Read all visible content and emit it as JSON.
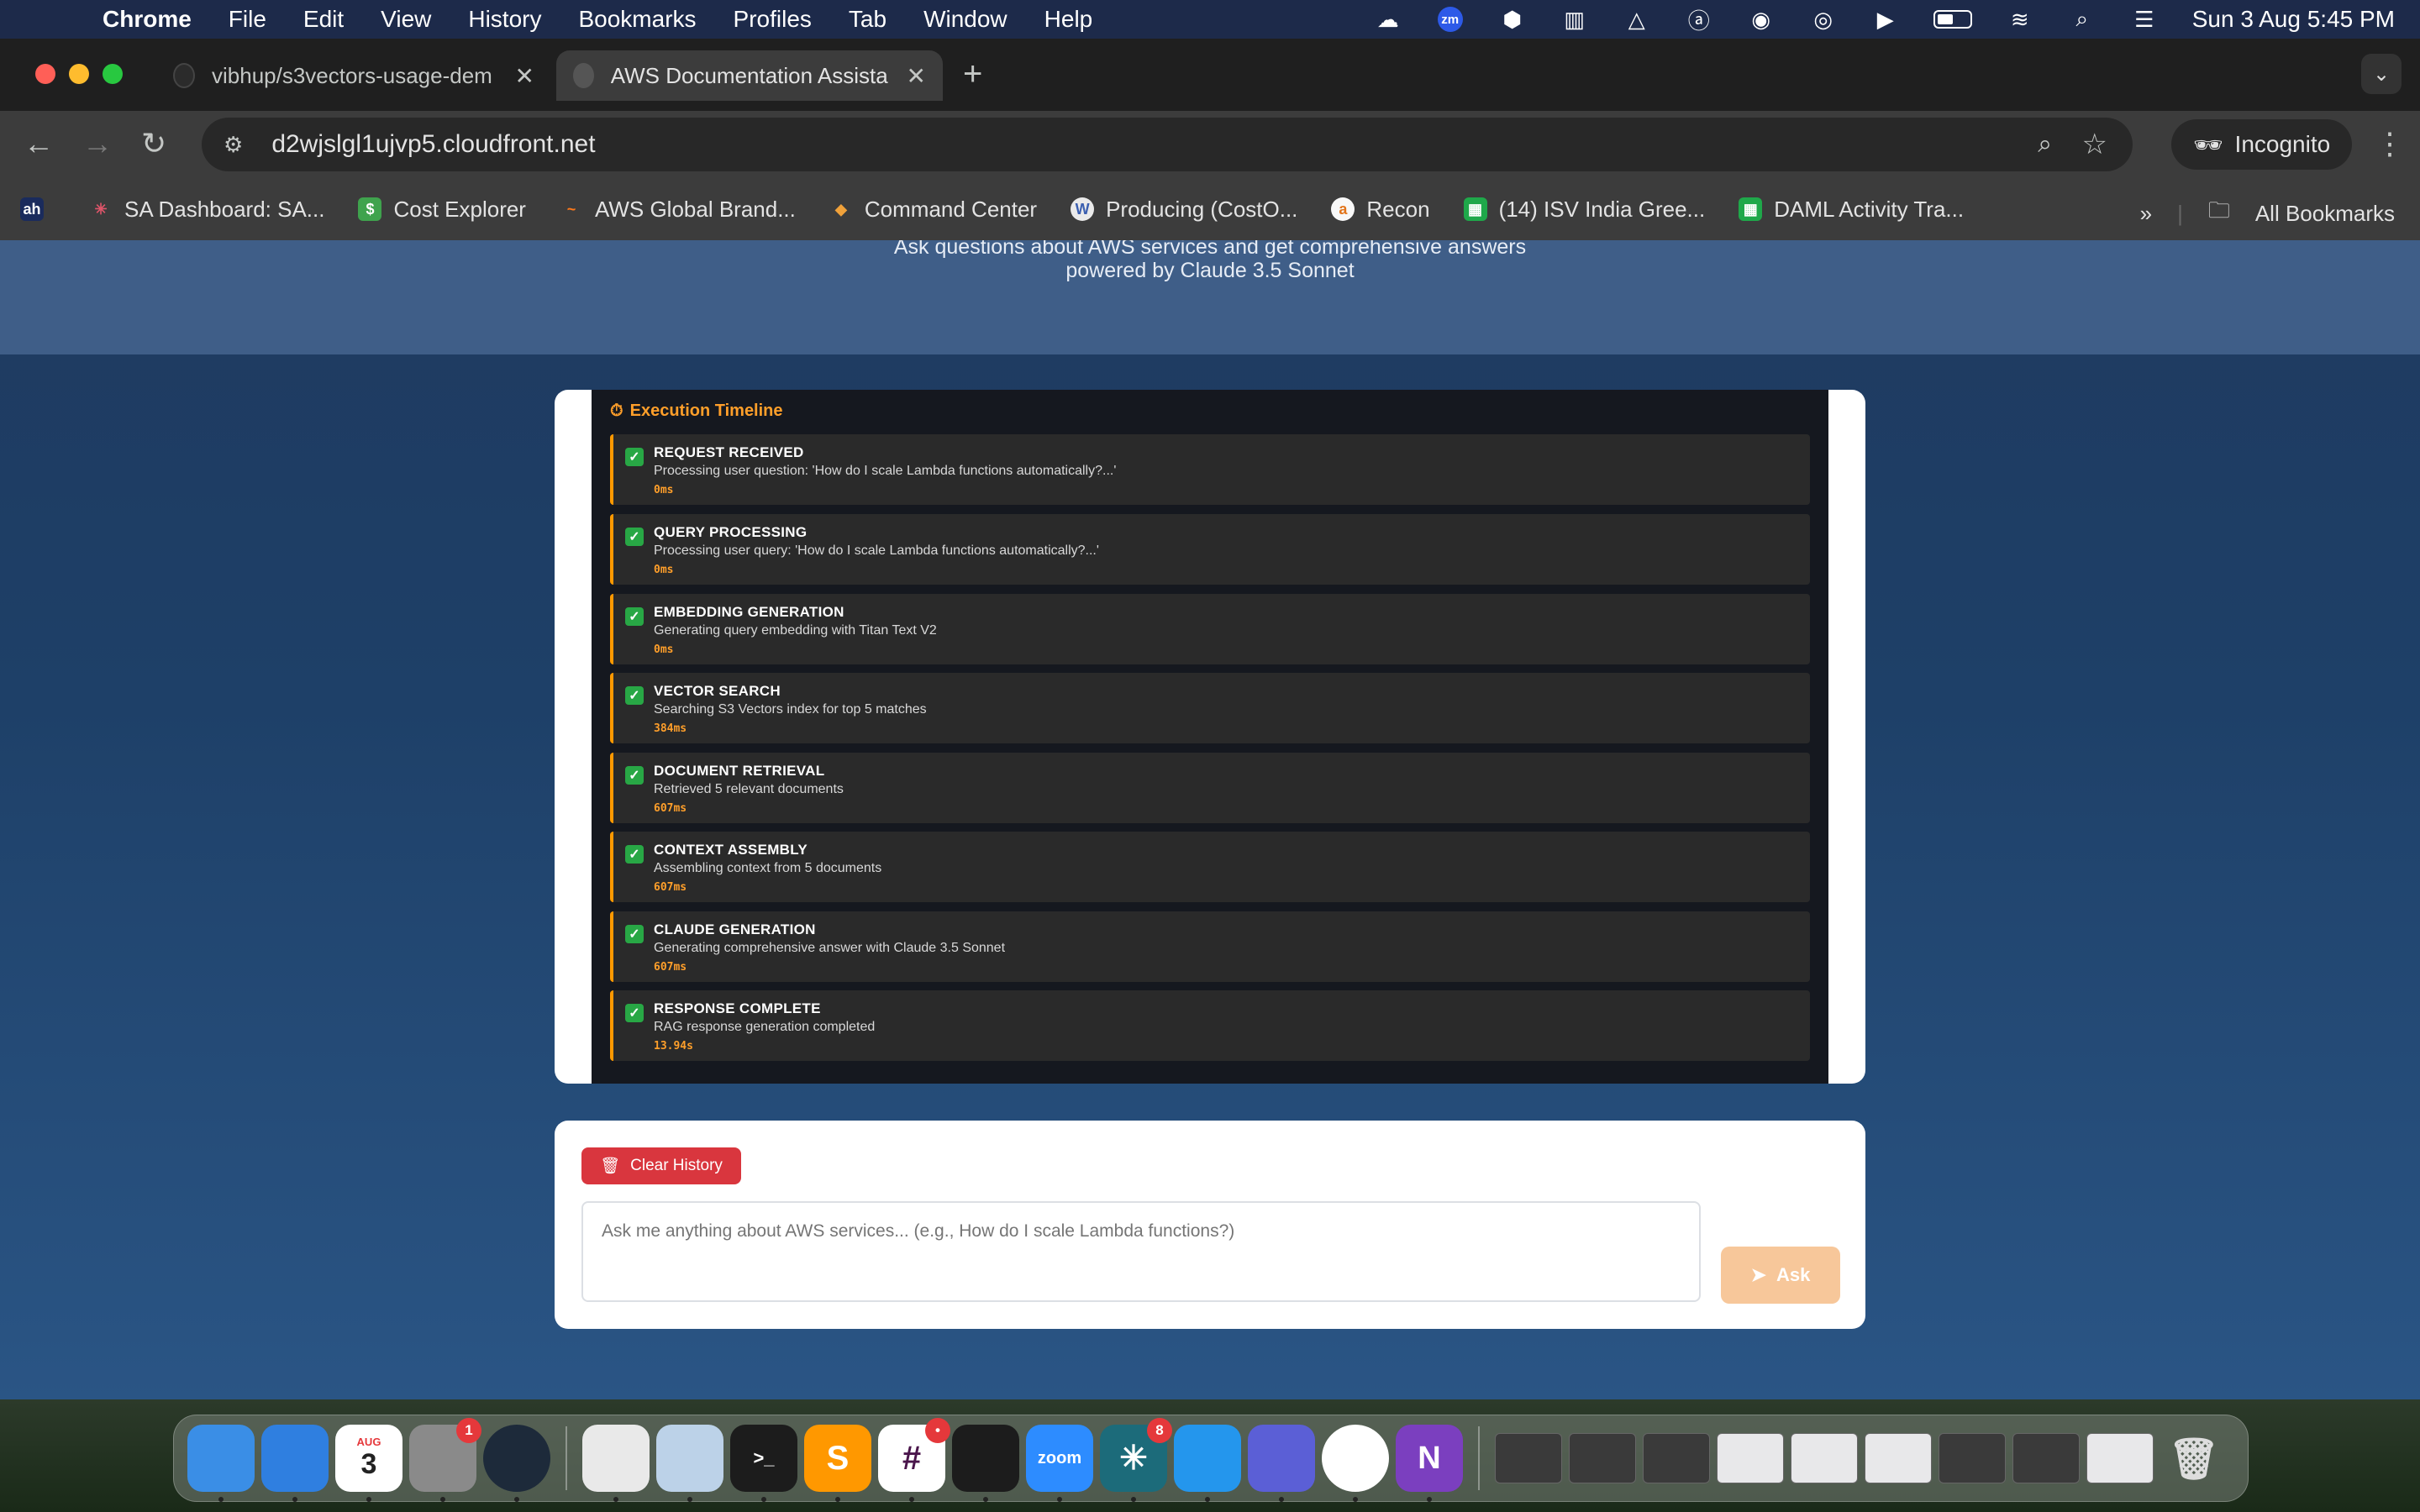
{
  "menubar": {
    "app": "Chrome",
    "items": [
      "File",
      "Edit",
      "View",
      "History",
      "Bookmarks",
      "Profiles",
      "Tab",
      "Window",
      "Help"
    ],
    "clock": "Sun 3 Aug  5:45 PM",
    "zoom_badge": "zm"
  },
  "browser": {
    "tabs": [
      {
        "title": "vibhup/s3vectors-usage-dem",
        "active": false
      },
      {
        "title": "AWS Documentation Assistan",
        "active": true
      }
    ],
    "url": "d2wjslgl1ujvp5.cloudfront.net",
    "incognito_label": "Incognito",
    "bookmarks": [
      {
        "label": "",
        "icon_text": "ah",
        "color": "#1a2b5c"
      },
      {
        "label": "SA Dashboard: SA...",
        "icon_text": "✳",
        "color": "#c4374b"
      },
      {
        "label": "Cost Explorer",
        "icon_text": "$",
        "color": "#3fa34d"
      },
      {
        "label": "AWS Global Brand...",
        "icon_text": "~",
        "color": "#ff7a1a"
      },
      {
        "label": "Command Center",
        "icon_text": "◆",
        "color": "#f0a13a"
      },
      {
        "label": "Producing (CostO...",
        "icon_text": "W",
        "color": "#eaeaea"
      },
      {
        "label": "Recon",
        "icon_text": "a",
        "color": "#f8f8f8"
      },
      {
        "label": "(14) ISV India Gree...",
        "icon_text": "▦",
        "color": "#1fa84a"
      },
      {
        "label": "DAML Activity Tra...",
        "icon_text": "▦",
        "color": "#1fa84a"
      }
    ],
    "all_bookmarks": "All Bookmarks"
  },
  "page": {
    "subtitle_line1": "Ask questions about AWS services and get comprehensive answers",
    "subtitle_line2": "powered by Claude 3.5 Sonnet",
    "timeline": {
      "title": "Execution Timeline",
      "steps": [
        {
          "title": "REQUEST RECEIVED",
          "desc": "Processing user question: 'How do I scale Lambda functions automatically?...'",
          "dur": "0ms"
        },
        {
          "title": "QUERY PROCESSING",
          "desc": "Processing user query: 'How do I scale Lambda functions automatically?...'",
          "dur": "0ms"
        },
        {
          "title": "EMBEDDING GENERATION",
          "desc": "Generating query embedding with Titan Text V2",
          "dur": "0ms"
        },
        {
          "title": "VECTOR SEARCH",
          "desc": "Searching S3 Vectors index for top 5 matches",
          "dur": "384ms"
        },
        {
          "title": "DOCUMENT RETRIEVAL",
          "desc": "Retrieved 5 relevant documents",
          "dur": "607ms"
        },
        {
          "title": "CONTEXT ASSEMBLY",
          "desc": "Assembling context from 5 documents",
          "dur": "607ms"
        },
        {
          "title": "CLAUDE GENERATION",
          "desc": "Generating comprehensive answer with Claude 3.5 Sonnet",
          "dur": "607ms"
        },
        {
          "title": "RESPONSE COMPLETE",
          "desc": "RAG response generation completed",
          "dur": "13.94s"
        }
      ]
    },
    "clear_history": "Clear History",
    "question_placeholder": "Ask me anything about AWS services... (e.g., How do I scale Lambda functions?)",
    "ask_label": "Ask"
  },
  "dock": {
    "apps": [
      {
        "name": "finder",
        "label": "",
        "color": "#3a8ee6"
      },
      {
        "name": "safari",
        "label": "",
        "color": "#2f7fe0"
      },
      {
        "name": "calendar",
        "label": "3",
        "color": "#ffffff",
        "sub": "AUG"
      },
      {
        "name": "system-settings",
        "label": "",
        "color": "#8a8a8a",
        "badge": "1"
      },
      {
        "name": "monitor-app",
        "label": "",
        "color": "#1d2a3a"
      },
      {
        "name": "textedit",
        "label": "",
        "color": "#e9e9e9"
      },
      {
        "name": "preview",
        "label": "",
        "color": "#bcd2e8"
      },
      {
        "name": "terminal",
        "label": ">_",
        "color": "#1c1c1c"
      },
      {
        "name": "sublime-text",
        "label": "S",
        "color": "#ff9800"
      },
      {
        "name": "slack",
        "label": "#",
        "color": "#ffffff",
        "badge": "•"
      },
      {
        "name": "activity-monitor",
        "label": "",
        "color": "#1c1c1c"
      },
      {
        "name": "zoom",
        "label": "zoom",
        "color": "#2d8cff"
      },
      {
        "name": "perplexity",
        "label": "✳",
        "color": "#1c6b7a",
        "badge": "8"
      },
      {
        "name": "docker",
        "label": "",
        "color": "#2496ed"
      },
      {
        "name": "workspaces",
        "label": "",
        "color": "#5b5fd6"
      },
      {
        "name": "chrome",
        "label": "",
        "color": "#ffffff"
      },
      {
        "name": "onenote",
        "label": "N",
        "color": "#7b3fbf"
      }
    ],
    "window_thumbnails": 9
  }
}
